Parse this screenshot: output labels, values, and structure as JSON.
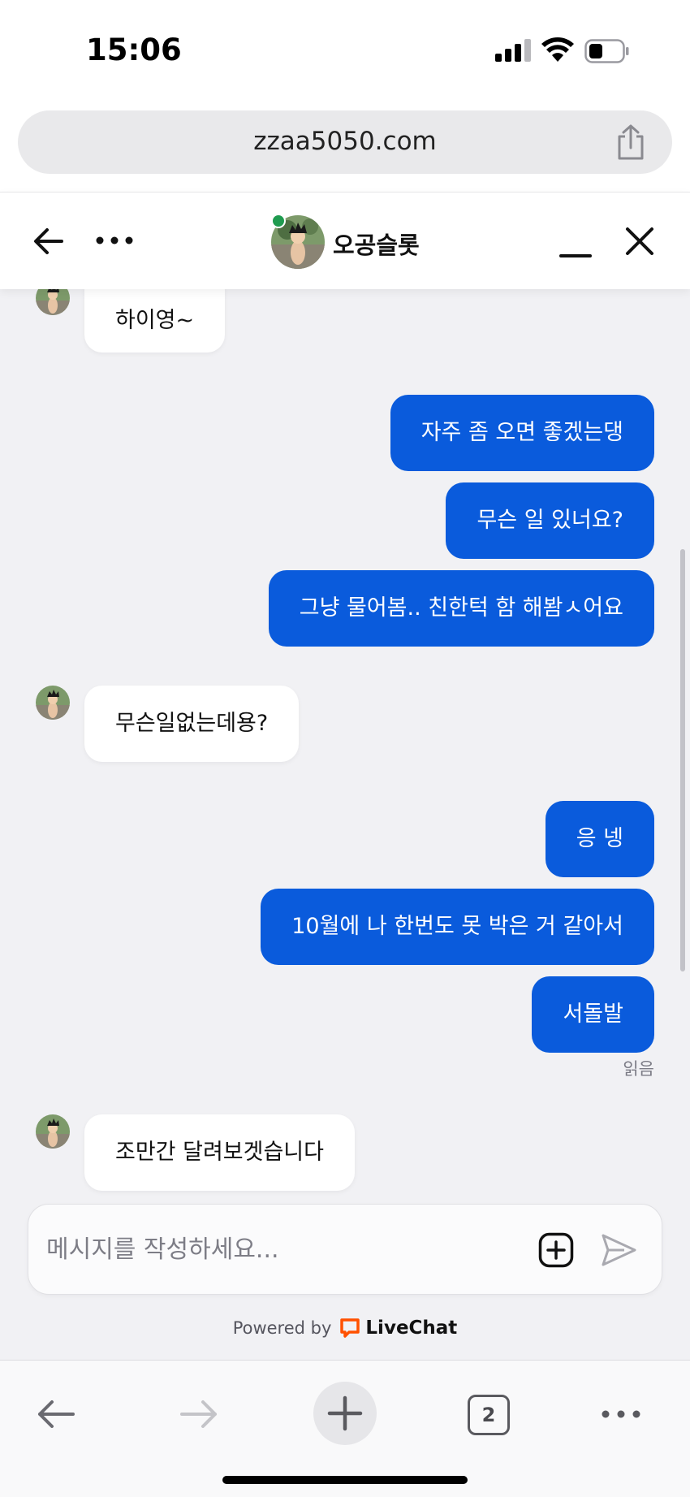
{
  "status_bar": {
    "time": "15:06"
  },
  "browser": {
    "url": "zzaa5050.com",
    "tab_count": "2"
  },
  "chat": {
    "agent_name": "오공슬롯",
    "messages": [
      {
        "dir": "in",
        "text": "하이영~"
      },
      {
        "dir": "out",
        "text": "자주 좀 오면 좋겠는댕"
      },
      {
        "dir": "out",
        "text": "무슨 일 있너요?"
      },
      {
        "dir": "out",
        "text": "그냥 물어봄.. 친한턱 함 해봠ㅅ어요"
      },
      {
        "dir": "in",
        "text": "무슨일없는데용?"
      },
      {
        "dir": "out",
        "text": "응 넹"
      },
      {
        "dir": "out",
        "text": "10월에 나 한번도 못 박은 거 같아서"
      },
      {
        "dir": "out",
        "text": "서돌발"
      },
      {
        "dir": "in",
        "text": "조만간 달려보겟습니다"
      }
    ],
    "read_receipt": "읽음",
    "composer_placeholder": "메시지를 작성하세요...",
    "powered_by": "Powered by",
    "brand": "LiveChat"
  },
  "colors": {
    "outgoing_bubble": "#0a5bdc",
    "incoming_bubble": "#ffffff",
    "online": "#1f9b4f",
    "livechat_orange": "#ff5100"
  },
  "icons": [
    "back-arrow-icon",
    "more-icon",
    "minimize-icon",
    "close-icon",
    "share-icon",
    "attach-icon",
    "send-icon",
    "livechat-icon",
    "new-tab-icon"
  ]
}
